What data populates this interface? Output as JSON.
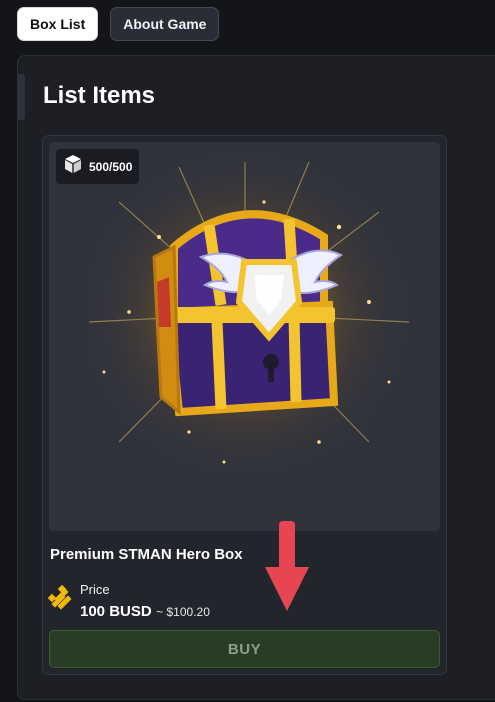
{
  "tabs": [
    {
      "label": "Box List",
      "active": true
    },
    {
      "label": "About Game",
      "active": false
    }
  ],
  "panel": {
    "title": "List Items"
  },
  "item": {
    "stock": "500/500",
    "name": "Premium STMAN Hero Box",
    "price_label": "Price",
    "price_value": "100 BUSD",
    "price_approx": "~ $100.20",
    "buy_label": "BUY"
  },
  "icons": {
    "stock": "cube-icon",
    "price": "busd-coin-icon",
    "annotation": "down-arrow-icon"
  },
  "colors": {
    "buy_button_bg": "#283d24",
    "coin": "#f0b90b",
    "annotation_arrow": "#e64552"
  }
}
